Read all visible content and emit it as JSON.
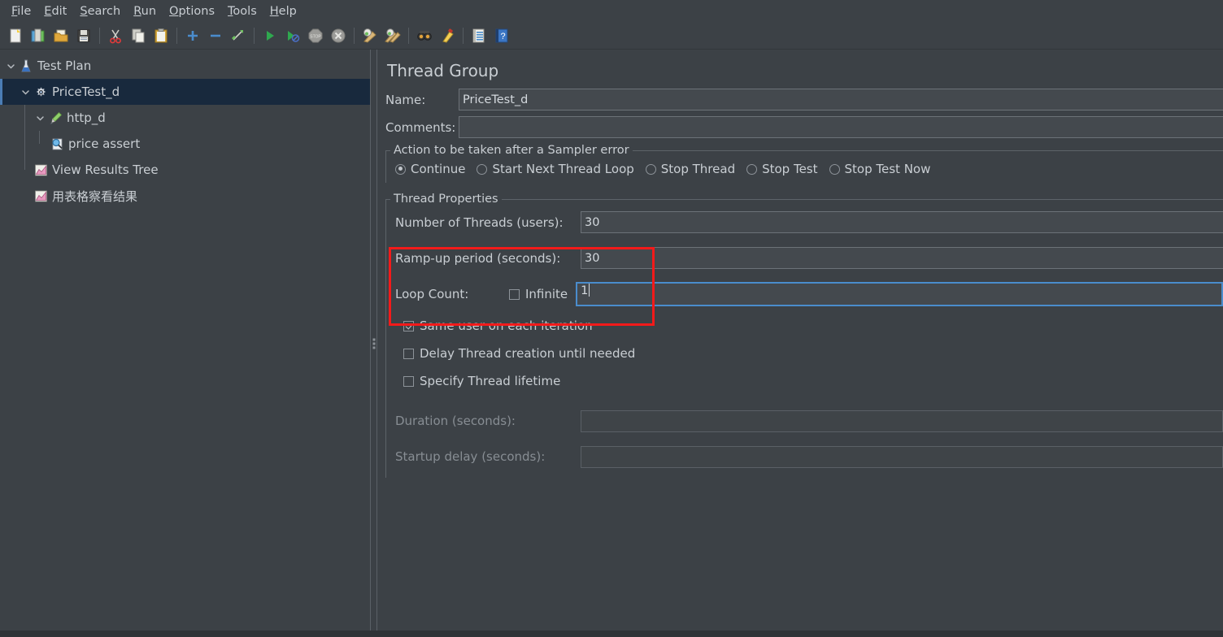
{
  "menubar": {
    "items": [
      {
        "mnemonic": "F",
        "rest": "ile"
      },
      {
        "mnemonic": "E",
        "rest": "dit"
      },
      {
        "mnemonic": "S",
        "rest": "earch"
      },
      {
        "mnemonic": "R",
        "rest": "un"
      },
      {
        "mnemonic": "O",
        "rest": "ptions"
      },
      {
        "mnemonic": "T",
        "rest": "ools"
      },
      {
        "mnemonic": "H",
        "rest": "elp"
      }
    ]
  },
  "toolbar": {
    "buttons": [
      {
        "name": "new-icon",
        "title": "New"
      },
      {
        "name": "templates-icon",
        "title": "Templates"
      },
      {
        "name": "open-icon",
        "title": "Open"
      },
      {
        "name": "save-icon",
        "title": "Save Test Plan"
      },
      {
        "name": "cut-icon",
        "title": "Cut"
      },
      {
        "name": "copy-icon",
        "title": "Copy"
      },
      {
        "name": "paste-icon",
        "title": "Paste"
      },
      {
        "name": "expand-all-icon",
        "title": "Expand All"
      },
      {
        "name": "collapse-all-icon",
        "title": "Collapse All"
      },
      {
        "name": "toggle-icon",
        "title": "Toggle"
      },
      {
        "name": "start-icon",
        "title": "Start"
      },
      {
        "name": "start-no-pauses-icon",
        "title": "Start no pauses"
      },
      {
        "name": "stop-icon",
        "title": "Stop"
      },
      {
        "name": "shutdown-icon",
        "title": "Shutdown"
      },
      {
        "name": "clear-icon",
        "title": "Clear"
      },
      {
        "name": "clear-all-icon",
        "title": "Clear All"
      },
      {
        "name": "search-icon",
        "title": "Search"
      },
      {
        "name": "reset-search-icon",
        "title": "Reset Search"
      },
      {
        "name": "function-helper-icon",
        "title": "Function Helper Dialog"
      },
      {
        "name": "help-icon",
        "title": "Help"
      }
    ]
  },
  "tree": {
    "nodes": [
      {
        "label": "Test Plan",
        "icon": "test-plan-icon",
        "depth": 0,
        "expanded": true,
        "selected": false,
        "hasTwisty": true
      },
      {
        "label": "PriceTest_d",
        "icon": "thread-group-icon",
        "depth": 1,
        "expanded": true,
        "selected": true,
        "hasTwisty": true
      },
      {
        "label": "http_d",
        "icon": "http-sampler-icon",
        "depth": 2,
        "expanded": true,
        "selected": false,
        "hasTwisty": true
      },
      {
        "label": "price assert",
        "icon": "assertion-icon",
        "depth": 3,
        "expanded": false,
        "selected": false,
        "hasTwisty": false
      },
      {
        "label": "View Results Tree",
        "icon": "listener-icon",
        "depth": 2,
        "expanded": false,
        "selected": false,
        "hasTwisty": false
      },
      {
        "label": "用表格察看结果",
        "icon": "listener-icon",
        "depth": 2,
        "expanded": false,
        "selected": false,
        "hasTwisty": false
      }
    ]
  },
  "panel": {
    "title": "Thread Group",
    "name_label": "Name:",
    "name_value": "PriceTest_d",
    "comments_label": "Comments:",
    "comments_value": "",
    "sampler_error": {
      "group_title": "Action to be taken after a Sampler error",
      "options": [
        {
          "label": "Continue",
          "selected": true
        },
        {
          "label": "Start Next Thread Loop",
          "selected": false
        },
        {
          "label": "Stop Thread",
          "selected": false
        },
        {
          "label": "Stop Test",
          "selected": false
        },
        {
          "label": "Stop Test Now",
          "selected": false
        }
      ]
    },
    "thread_properties": {
      "group_title": "Thread Properties",
      "num_threads_label": "Number of Threads (users):",
      "num_threads_value": "30",
      "rampup_label": "Ramp-up period (seconds):",
      "rampup_value": "30",
      "loop_count_label": "Loop Count:",
      "infinite_label": "Infinite",
      "infinite_checked": false,
      "loop_count_value": "1",
      "same_user_label": "Same user on each iteration",
      "same_user_checked": true,
      "delay_thread_label": "Delay Thread creation until needed",
      "delay_thread_checked": false,
      "specify_lifetime_label": "Specify Thread lifetime",
      "specify_lifetime_checked": false,
      "duration_label": "Duration (seconds):",
      "duration_value": "",
      "startup_delay_label": "Startup delay (seconds):",
      "startup_delay_value": ""
    }
  },
  "annotation": {
    "highlight_color": "#f31a1a",
    "highlight_target": "thread-properties-fields"
  },
  "colors": {
    "window_bg": "#3c4146",
    "selection_bg": "#18293d",
    "selection_accent": "#4b7db5",
    "field_bg": "#44494e",
    "focus_border": "#4a8ccc",
    "text": "#c9ced3",
    "text_disabled": "#878d93"
  }
}
